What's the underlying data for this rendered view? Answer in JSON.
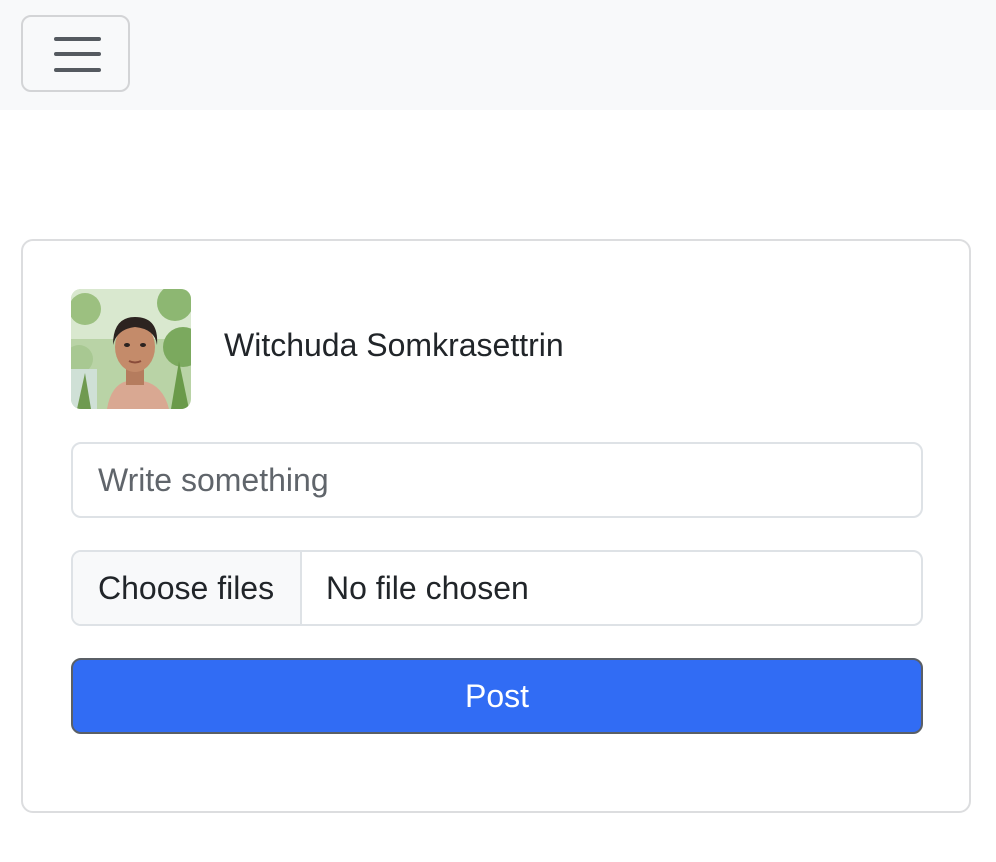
{
  "navbar": {
    "toggler_icon": "hamburger-menu-icon"
  },
  "post_form": {
    "user": {
      "name": "Witchuda Somkrasettrin",
      "avatar_icon": "user-avatar-photo"
    },
    "text_input": {
      "value": "",
      "placeholder": "Write something"
    },
    "file_input": {
      "button_label": "Choose files",
      "status_text": "No file chosen"
    },
    "submit_label": "Post"
  },
  "colors": {
    "navbar_bg": "#f8f9fa",
    "primary": "#316cf4",
    "border": "#dee2e6",
    "text": "#212529"
  }
}
